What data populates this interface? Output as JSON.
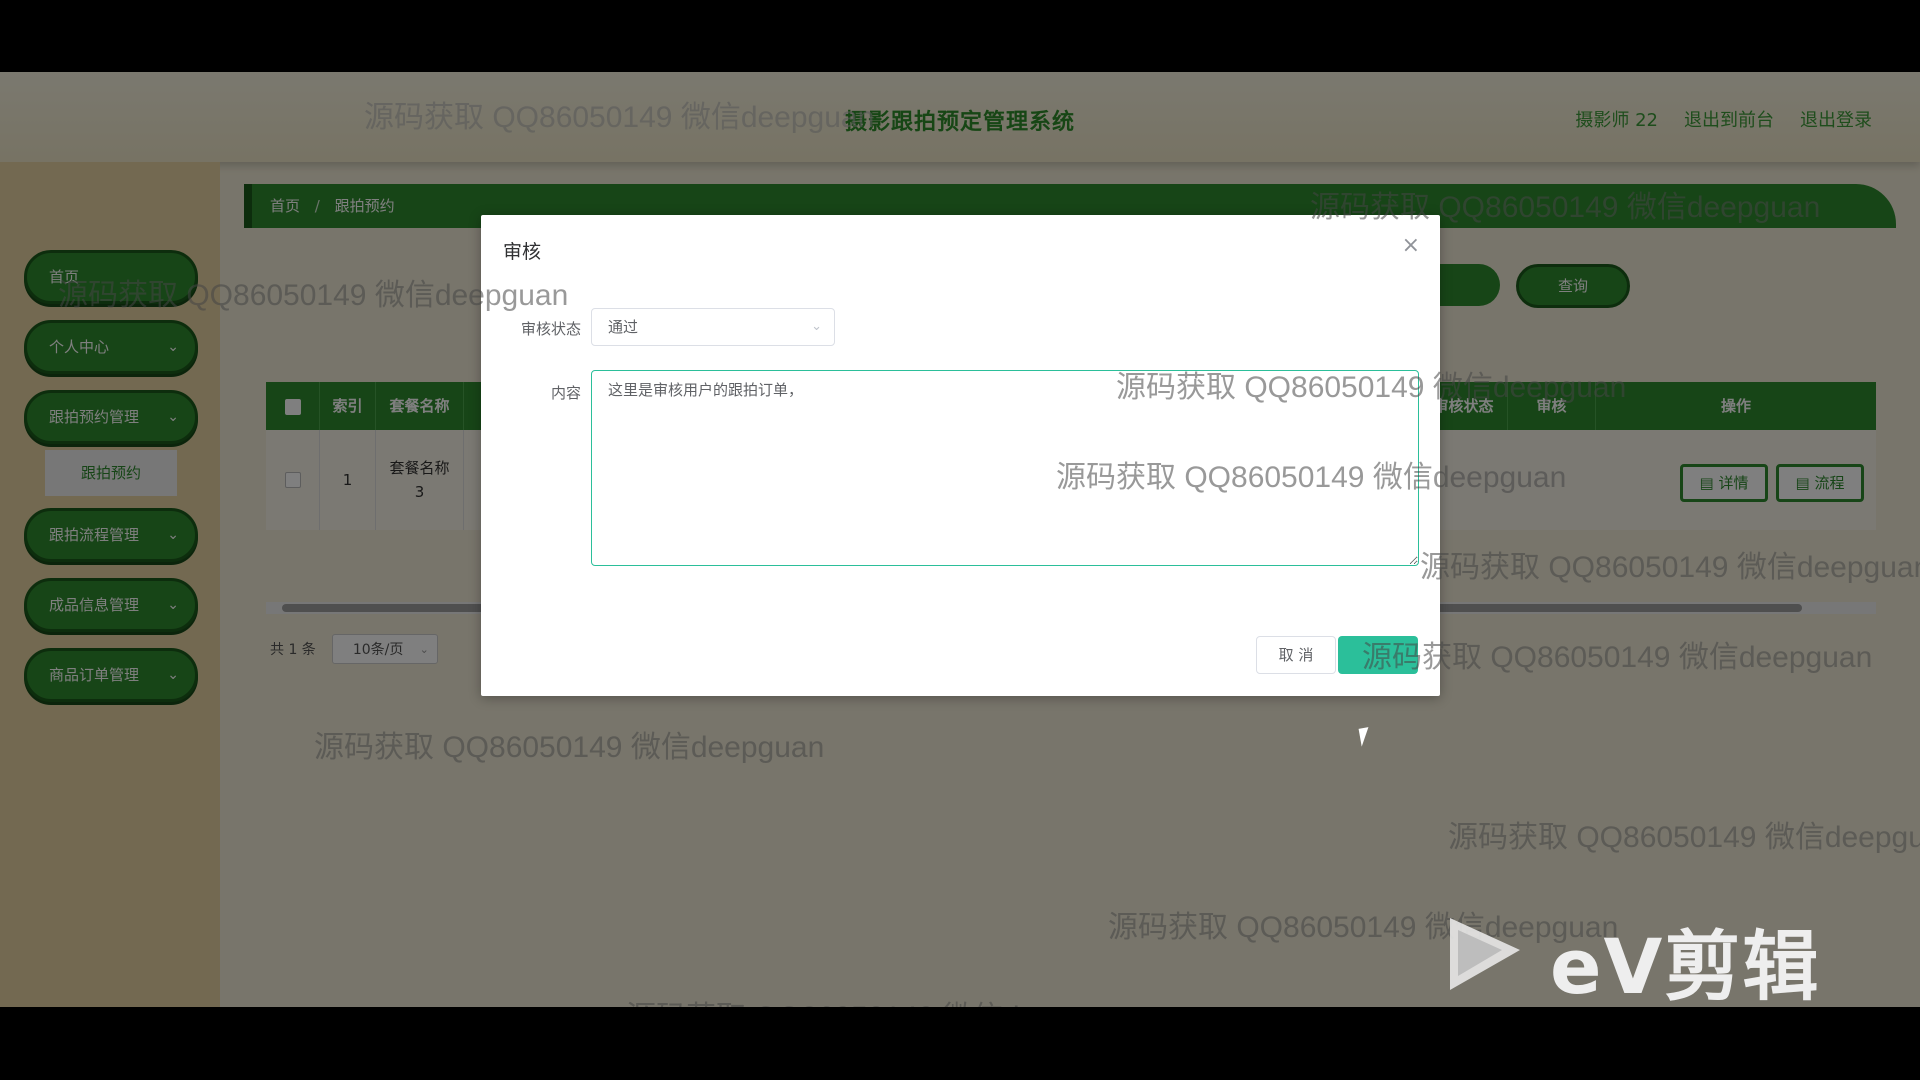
{
  "header": {
    "app_title": "摄影跟拍预定管理系统",
    "user": "摄影师 22",
    "back_front": "退出到前台",
    "logout": "退出登录"
  },
  "sidebar": {
    "items": [
      {
        "label": "首页"
      },
      {
        "label": "个人中心"
      },
      {
        "label": "跟拍预约管理"
      },
      {
        "label": "跟拍流程管理"
      },
      {
        "label": "成品信息管理"
      },
      {
        "label": "商品订单管理"
      }
    ],
    "sub_item": "跟拍预约"
  },
  "breadcrumb": {
    "home": "首页",
    "sep": "/",
    "current": "跟拍预约"
  },
  "search": {
    "button": "查询"
  },
  "table": {
    "headers": {
      "index": "索引",
      "package": "套餐名称",
      "review_status": "审核状态",
      "review": "审核",
      "actions": "操作"
    },
    "row": {
      "index": "1",
      "package": "套餐名称3"
    },
    "actions": {
      "detail": "详情",
      "flow": "流程"
    }
  },
  "pagination": {
    "total": "共 1 条",
    "page_size": "10条/页"
  },
  "dialog": {
    "title": "审核",
    "status_label": "审核状态",
    "status_value": "通过",
    "content_label": "内容",
    "content_value": "这里是审核用户的跟拍订单，",
    "cancel": "取 消"
  },
  "watermark": "源码获取 QQ86050149 微信deepguan",
  "editor_logo": "eV剪辑"
}
